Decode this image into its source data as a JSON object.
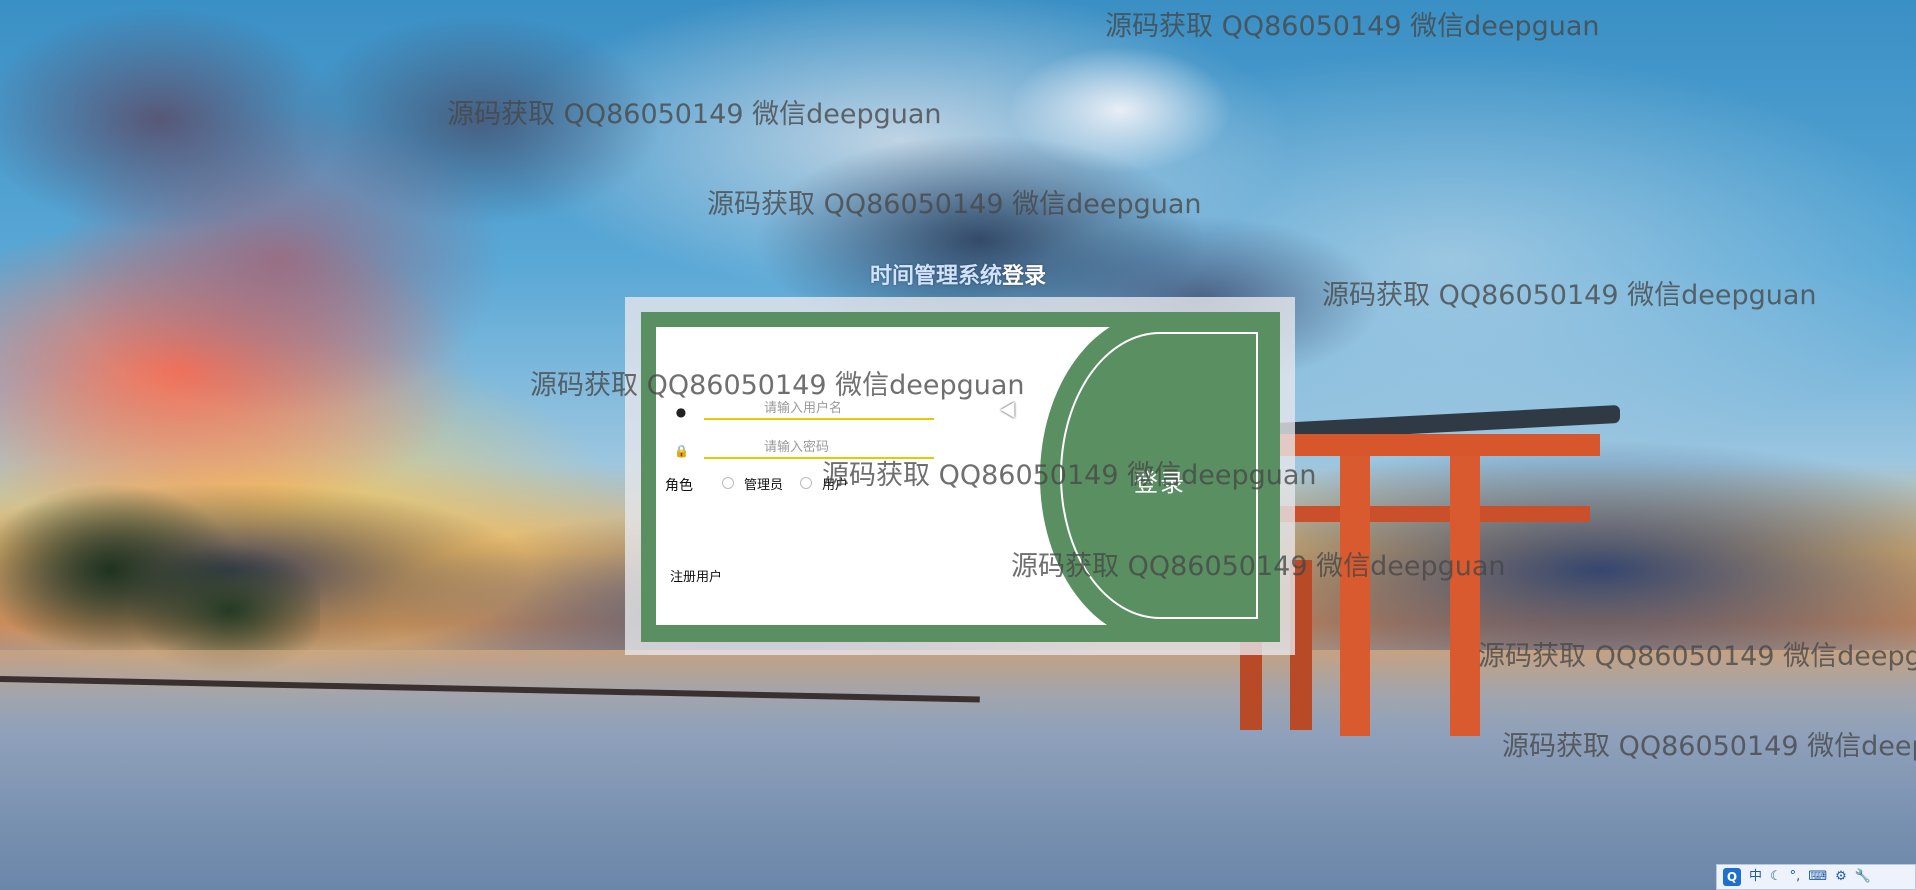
{
  "page": {
    "title_part1": "时间管理系统",
    "title_part2": "登录"
  },
  "login": {
    "username_placeholder": "请输入用户名",
    "password_placeholder": "请输入密码",
    "role_label": "角色",
    "role_options": [
      "管理员",
      "用户"
    ],
    "submit_label": "登录",
    "register_label": "注册用户"
  },
  "icons": {
    "user": "user-icon",
    "lock": "lock-icon"
  },
  "watermark": {
    "text": "源码获取 QQ86050149 微信deepguan"
  },
  "tray": {
    "ime_logo": "Q",
    "ime_mode": "中"
  },
  "colors": {
    "panel_green": "#5a8f62",
    "field_underline": "#e6c900",
    "title_accent": "#cfe3ff"
  }
}
